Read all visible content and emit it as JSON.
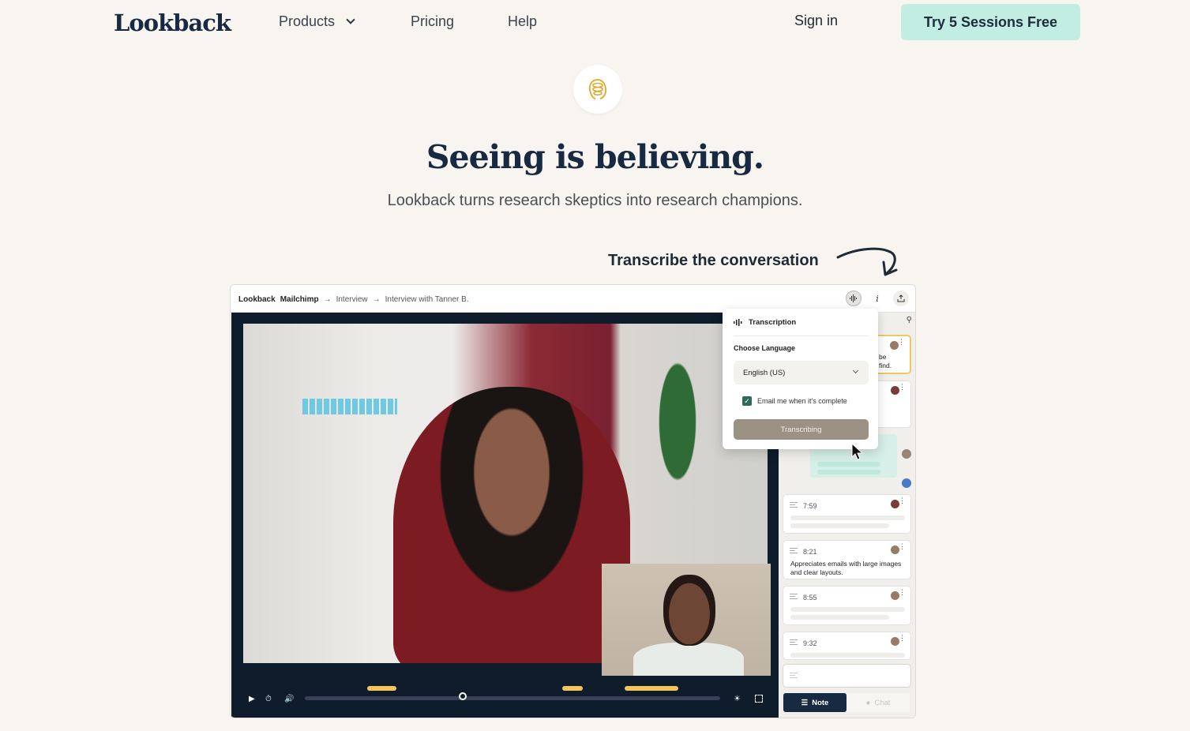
{
  "nav": {
    "logo": "Lookback",
    "links": [
      "Products",
      "Pricing",
      "Help"
    ],
    "sign_in": "Sign in",
    "cta": "Try 5 Sessions Free"
  },
  "hero": {
    "badge_icon": "spiral-icon",
    "title": "Seeing is believing.",
    "subtitle": "Lookback turns research skeptics into research champions.",
    "callout": "Transcribe the conversation"
  },
  "app": {
    "breadcrumb": {
      "brand": "Lookback",
      "project": "Mailchimp",
      "sep": "→",
      "section": "Interview",
      "session": "Interview with Tanner B."
    },
    "toolbar_icons": [
      "waveform-icon",
      "info-icon",
      "share-icon"
    ],
    "info_glyph": "i",
    "transcription": {
      "title": "Transcription",
      "language_label": "Choose Language",
      "language_value": "English (US)",
      "email_checkbox_label": "Email me when it's complete",
      "email_checked": true,
      "button": "Transcribing"
    },
    "player": {
      "progress_percent": 38,
      "highlights": [
        {
          "start": 15,
          "end": 22
        },
        {
          "start": 62,
          "end": 67
        },
        {
          "start": 77,
          "end": 90
        }
      ]
    },
    "notes": [
      {
        "partial_text": "be\n find.",
        "highlighted": true
      },
      {
        "time": "",
        "partial": true
      },
      {
        "time": "7:59",
        "text": ""
      },
      {
        "time": "8:21",
        "text": "Appreciates emails with large images and clear layouts."
      },
      {
        "time": "8:55",
        "text": ""
      },
      {
        "time": "9:32",
        "text": ""
      }
    ],
    "tabs": {
      "note": "Note",
      "chat": "Chat"
    }
  }
}
